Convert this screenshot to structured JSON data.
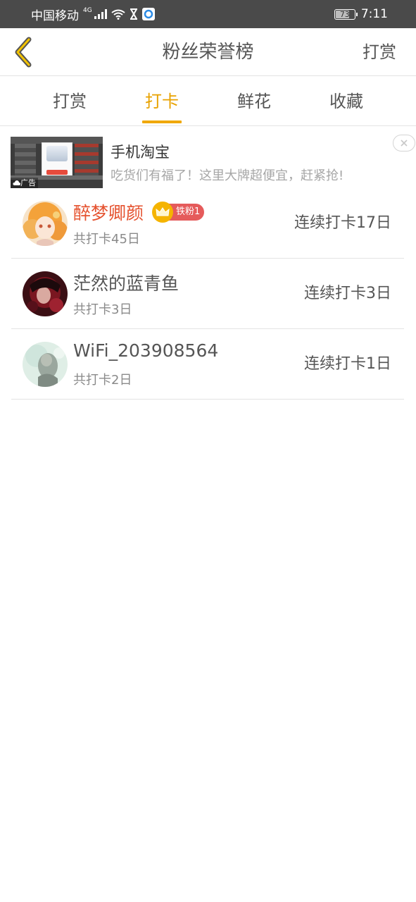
{
  "status_bar": {
    "carrier": "中国移动",
    "network": "4G",
    "battery": "73",
    "battery_level": 0.73,
    "time": "7:11"
  },
  "header": {
    "title": "粉丝荣誉榜",
    "action": "打赏",
    "back_icon": "chevron-left-icon"
  },
  "tabs": [
    {
      "label": "打赏",
      "active": false
    },
    {
      "label": "打卡",
      "active": true
    },
    {
      "label": "鲜花",
      "active": false
    },
    {
      "label": "收藏",
      "active": false
    }
  ],
  "ad": {
    "title": "手机淘宝",
    "description": "吃货们有福了！这里大牌超便宜，赶紧抢!",
    "badge": "广告"
  },
  "fans": [
    {
      "name": "醉梦卿颜",
      "total": "共打卡45日",
      "streak": "连续打卡17日",
      "badge": "铁粉1",
      "highlight": true
    },
    {
      "name": "茫然的蓝青鱼",
      "total": "共打卡3日",
      "streak": "连续打卡3日"
    },
    {
      "name": "WiFi_203908564",
      "total": "共打卡2日",
      "streak": "连续打卡1日"
    }
  ],
  "colors": {
    "accent": "#f0a800",
    "highlight_name": "#e5522f",
    "badge_bg": "#e55b5b",
    "crown": "#f5b400"
  }
}
